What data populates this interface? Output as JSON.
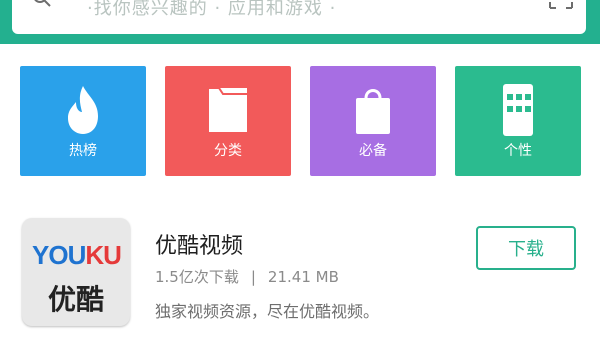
{
  "header": {
    "search_placeholder": "·找你感兴趣的 · 应用和游戏 ·"
  },
  "tiles": [
    {
      "label": "热榜",
      "icon": "flame-icon",
      "color": "#2aa1ea"
    },
    {
      "label": "分类",
      "icon": "folder-icon",
      "color": "#f25a5a"
    },
    {
      "label": "必备",
      "icon": "shopping-bag-icon",
      "color": "#a76ee3"
    },
    {
      "label": "个性",
      "icon": "phone-theme-icon",
      "color": "#2bbb8f"
    }
  ],
  "app": {
    "name": "优酷视频",
    "downloads": "1.5亿次下载",
    "separator": "|",
    "size": "21.41 MB",
    "description": "独家视频资源，尽在优酷视频。",
    "download_label": "下载",
    "logo_word_you": "YOU",
    "logo_word_ku": "KU",
    "logo_cn": "优酷"
  },
  "colors": {
    "accent": "#23b08f",
    "download_button": "#28b08c"
  }
}
